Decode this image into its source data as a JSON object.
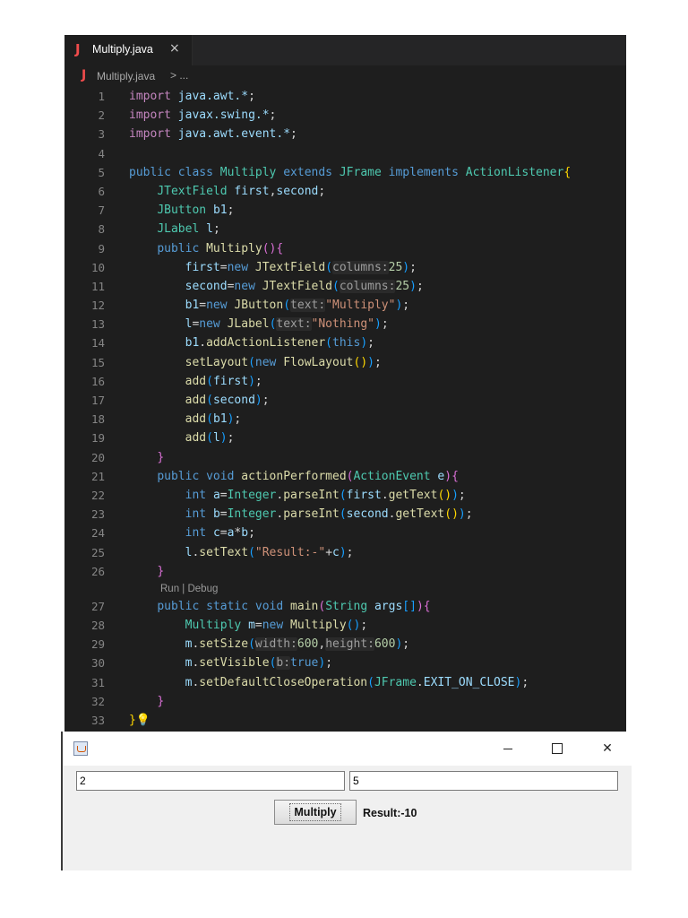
{
  "editor": {
    "tab": {
      "icon": "J",
      "name": "Multiply.java",
      "close": "×"
    },
    "breadcrumb": {
      "icon": "J",
      "file": "Multiply.java",
      "rest": "> ..."
    },
    "codelens": "Run | Debug",
    "line_numbers": [
      "1",
      "2",
      "3",
      "4",
      "5",
      "6",
      "7",
      "8",
      "9",
      "10",
      "11",
      "12",
      "13",
      "14",
      "15",
      "16",
      "17",
      "18",
      "19",
      "20",
      "21",
      "22",
      "23",
      "24",
      "25",
      "26",
      "27",
      "28",
      "29",
      "30",
      "31",
      "32",
      "33"
    ],
    "code": {
      "imp1": "java.awt.*",
      "imp2": "javax.swing.*",
      "imp3": "java.awt.event.*",
      "class_name": "Multiply",
      "super_class": "JFrame",
      "iface": "ActionListener",
      "hint_columns": "columns:",
      "hint_text": "text:",
      "hint_width": "width:",
      "hint_height": "height:",
      "hint_b": "b:",
      "str_multiply": "\"Multiply\"",
      "str_nothing": "\"Nothing\"",
      "str_result": "\"Result:-\"",
      "num_25": "25",
      "num_600": "600"
    }
  },
  "app": {
    "title_icon": "java-cup-icon",
    "field1_value": "2",
    "field2_value": "5",
    "button_label": "Multiply",
    "result_label": "Result:-10"
  }
}
